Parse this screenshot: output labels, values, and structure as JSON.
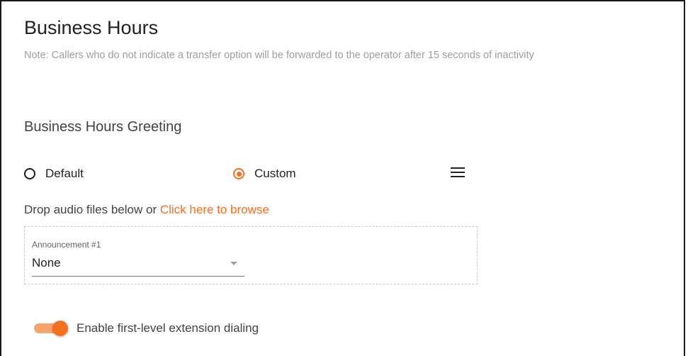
{
  "section": {
    "title": "Business Hours",
    "note": "Note: Callers who do not indicate a transfer option will be forwarded to the operator after 15 seconds of inactivity"
  },
  "greeting": {
    "title": "Business Hours Greeting",
    "options": [
      {
        "label": "Default",
        "selected": false
      },
      {
        "label": "Custom",
        "selected": true
      }
    ],
    "menu_icon": "hamburger-menu-icon"
  },
  "upload": {
    "prompt": "Drop audio files below or ",
    "browse_link": "Click here to browse"
  },
  "announcement": {
    "label": "Announcement #1",
    "value": "None"
  },
  "extension_dialing": {
    "label": "Enable first-level extension dialing",
    "enabled": true
  },
  "colors": {
    "accent": "#f37021",
    "accent_light": "#f7a46e",
    "muted_text": "#9e9e9e"
  }
}
